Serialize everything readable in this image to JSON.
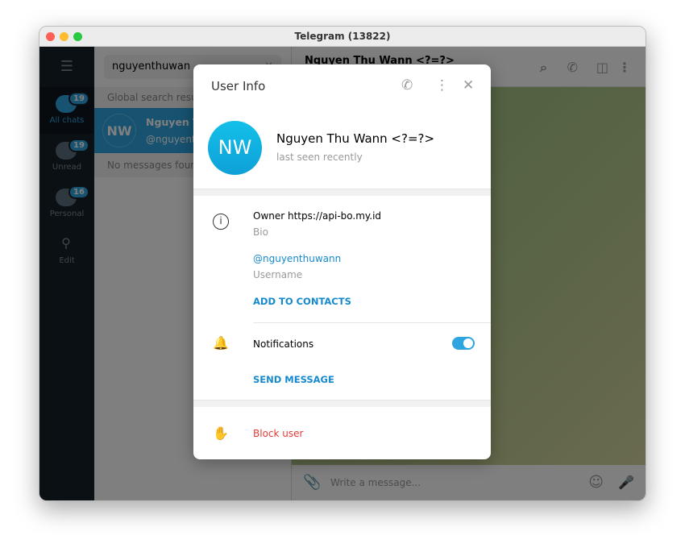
{
  "window": {
    "title": "Telegram (13822)"
  },
  "sidebar": {
    "items": [
      {
        "label": "All chats",
        "badge": "19"
      },
      {
        "label": "Unread",
        "badge": "19"
      },
      {
        "label": "Personal",
        "badge": "16"
      },
      {
        "label": "Edit"
      }
    ]
  },
  "list": {
    "search_value": "nguyenthuwan",
    "section": "Global search results",
    "result": {
      "initials": "NW",
      "name": "Nguyen Thu Wann <?=?>",
      "username": "@nguyenthuwann"
    },
    "empty": "No messages found"
  },
  "chat": {
    "title": "Nguyen Thu Wann <?=?>",
    "composer_placeholder": "Write a message..."
  },
  "modal": {
    "title": "User Info",
    "initials": "NW",
    "name": "Nguyen Thu Wann <?=?>",
    "status": "last seen recently",
    "bio": "Owner https://api-bo.my.id",
    "bio_label": "Bio",
    "username": "@nguyenthuwann",
    "username_label": "Username",
    "add_contact": "ADD TO CONTACTS",
    "notifications": "Notifications",
    "notifications_on": true,
    "send_message": "SEND MESSAGE",
    "block": "Block user"
  },
  "colors": {
    "accent": "#2ea5e0",
    "danger": "#e53935",
    "sidebar": "#17212b"
  }
}
